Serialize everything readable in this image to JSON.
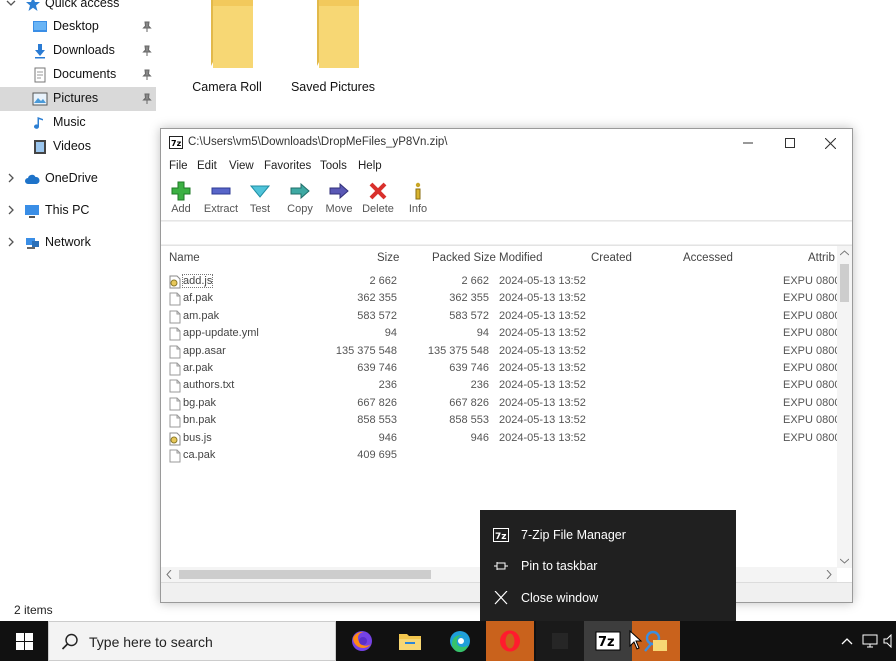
{
  "explorer": {
    "nav": [
      {
        "label": "Quick access",
        "icon": "star-icon"
      },
      {
        "label": "Desktop",
        "icon": "desktop-icon",
        "pinned": true
      },
      {
        "label": "Downloads",
        "icon": "download-arrow-icon",
        "pinned": true
      },
      {
        "label": "Documents",
        "icon": "documents-icon",
        "pinned": true
      },
      {
        "label": "Pictures",
        "icon": "pictures-icon",
        "pinned": true,
        "selected": true
      },
      {
        "label": "Music",
        "icon": "music-note-icon"
      },
      {
        "label": "Videos",
        "icon": "videos-icon"
      },
      {
        "label": "OneDrive",
        "icon": "cloud-icon"
      },
      {
        "label": "This PC",
        "icon": "computer-icon"
      },
      {
        "label": "Network",
        "icon": "network-icon"
      }
    ],
    "folders": [
      {
        "label": "Camera Roll"
      },
      {
        "label": "Saved Pictures"
      }
    ],
    "status": "2 items"
  },
  "zip": {
    "title": "C:\\Users\\vm5\\Downloads\\DropMeFiles_yP8Vn.zip\\",
    "menu": [
      "File",
      "Edit",
      "View",
      "Favorites",
      "Tools",
      "Help"
    ],
    "toolbar": [
      "Add",
      "Extract",
      "Test",
      "Copy",
      "Move",
      "Delete",
      "Info"
    ],
    "columns": {
      "name": "Name",
      "size": "Size",
      "packed": "Packed Size",
      "modified": "Modified",
      "created": "Created",
      "accessed": "Accessed",
      "attrib": "Attrib"
    },
    "rows": [
      {
        "name": "add.js",
        "size": "2 662",
        "packed": "2 662",
        "modified": "2024-05-13 13:52",
        "attrib": "EXPU 0800",
        "type": "script"
      },
      {
        "name": "af.pak",
        "size": "362 355",
        "packed": "362 355",
        "modified": "2024-05-13 13:52",
        "attrib": "EXPU 0800",
        "type": "file"
      },
      {
        "name": "am.pak",
        "size": "583 572",
        "packed": "583 572",
        "modified": "2024-05-13 13:52",
        "attrib": "EXPU 0800",
        "type": "file"
      },
      {
        "name": "app-update.yml",
        "size": "94",
        "packed": "94",
        "modified": "2024-05-13 13:52",
        "attrib": "EXPU 0800",
        "type": "file"
      },
      {
        "name": "app.asar",
        "size": "135 375 548",
        "packed": "135 375 548",
        "modified": "2024-05-13 13:52",
        "attrib": "EXPU 0800",
        "type": "file"
      },
      {
        "name": "ar.pak",
        "size": "639 746",
        "packed": "639 746",
        "modified": "2024-05-13 13:52",
        "attrib": "EXPU 0800",
        "type": "file"
      },
      {
        "name": "authors.txt",
        "size": "236",
        "packed": "236",
        "modified": "2024-05-13 13:52",
        "attrib": "EXPU 0800",
        "type": "file"
      },
      {
        "name": "bg.pak",
        "size": "667 826",
        "packed": "667 826",
        "modified": "2024-05-13 13:52",
        "attrib": "EXPU 0800",
        "type": "file"
      },
      {
        "name": "bn.pak",
        "size": "858 553",
        "packed": "858 553",
        "modified": "2024-05-13 13:52",
        "attrib": "EXPU 0800",
        "type": "file"
      },
      {
        "name": "bus.js",
        "size": "946",
        "packed": "946",
        "modified": "2024-05-13 13:52",
        "attrib": "EXPU 0800",
        "type": "script"
      },
      {
        "name": "ca.pak",
        "size": "409 695",
        "packed": "",
        "modified": "",
        "attrib": "",
        "type": "file"
      }
    ]
  },
  "jumplist": [
    {
      "label": "7-Zip File Manager",
      "icon": "seven-zip-icon"
    },
    {
      "label": "Pin to taskbar",
      "icon": "pin-icon"
    },
    {
      "label": "Close window",
      "icon": "close-icon"
    }
  ],
  "taskbar": {
    "search_placeholder": "Type here to search",
    "apps": [
      {
        "name": "firefox",
        "icon": "firefox-icon"
      },
      {
        "name": "file-explorer",
        "icon": "file-explorer-icon"
      },
      {
        "name": "edge",
        "icon": "edge-icon"
      },
      {
        "name": "opera",
        "icon": "opera-icon",
        "highlighted": true
      },
      {
        "name": "blank",
        "icon": "app-icon"
      },
      {
        "name": "7-zip",
        "icon": "seven-zip-icon",
        "active": true
      },
      {
        "name": "photos",
        "icon": "photos-icon",
        "highlighted": true
      }
    ]
  },
  "colors": {
    "folder": "#f7d774",
    "selection": "#d9d9d9",
    "taskbar": "#111111",
    "jumplist": "#202020",
    "accent": "#0078d7"
  }
}
